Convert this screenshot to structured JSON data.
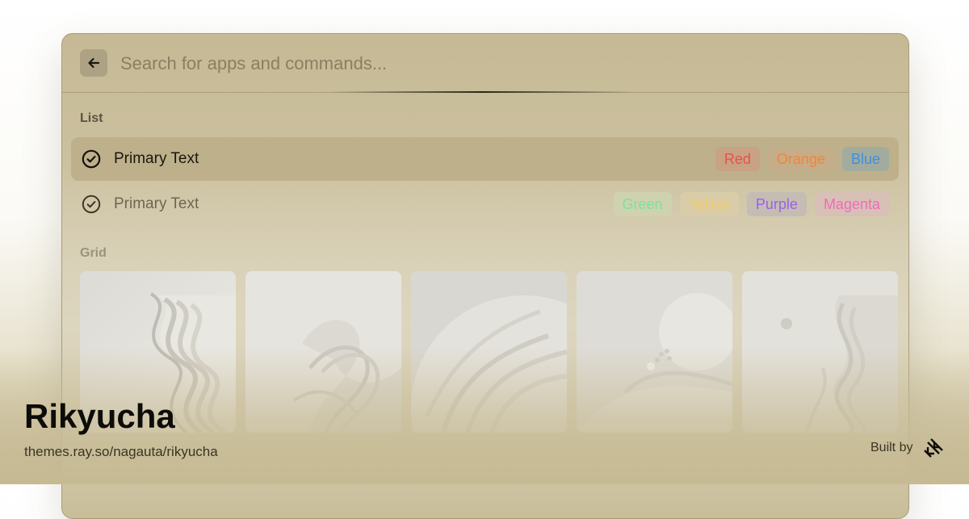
{
  "search": {
    "placeholder": "Search for apps and commands...",
    "back_icon": "arrow-left-icon"
  },
  "list": {
    "section_label": "List",
    "rows": [
      {
        "text": "Primary Text",
        "icon": "check-circle-icon",
        "selected": true,
        "tags": [
          {
            "label": "Red",
            "color": "#e5534b",
            "bg": "#c9a284"
          },
          {
            "label": "Orange",
            "color": "#f0863a",
            "bg": "#c6ad89"
          },
          {
            "label": "Blue",
            "color": "#3d8fe0",
            "bg": "#a2ac9e"
          }
        ]
      },
      {
        "text": "Primary Text",
        "icon": "check-circle-icon",
        "selected": false,
        "tags": [
          {
            "label": "Green",
            "color": "#7fe0a0",
            "bg": "#cfd2ae"
          },
          {
            "label": "Yellow",
            "color": "#f2cb6b",
            "bg": "#d9cca8"
          },
          {
            "label": "Purple",
            "color": "#9a62e6",
            "bg": "#c5bcb4"
          },
          {
            "label": "Magenta",
            "color": "#f06cb8",
            "bg": "#d8c0b6"
          }
        ]
      }
    ]
  },
  "grid": {
    "section_label": "Grid",
    "items": [
      {
        "icon": "abstract-wave-image"
      },
      {
        "icon": "abstract-wave-image"
      },
      {
        "icon": "abstract-wave-image"
      },
      {
        "icon": "abstract-sphere-image"
      },
      {
        "icon": "abstract-wave-image"
      }
    ]
  },
  "footer": {
    "theme_name": "Rikyucha",
    "theme_url": "themes.ray.so/nagauta/rikyucha",
    "built_by": "Built by",
    "logo_icon": "raycast-logo-icon"
  },
  "colors": {
    "window_bg": "#c6ba95",
    "selected_row": "#bdb08a",
    "text_primary": "#1f1b10",
    "text_secondary": "#6e6650",
    "section_label": "#5a5440"
  }
}
